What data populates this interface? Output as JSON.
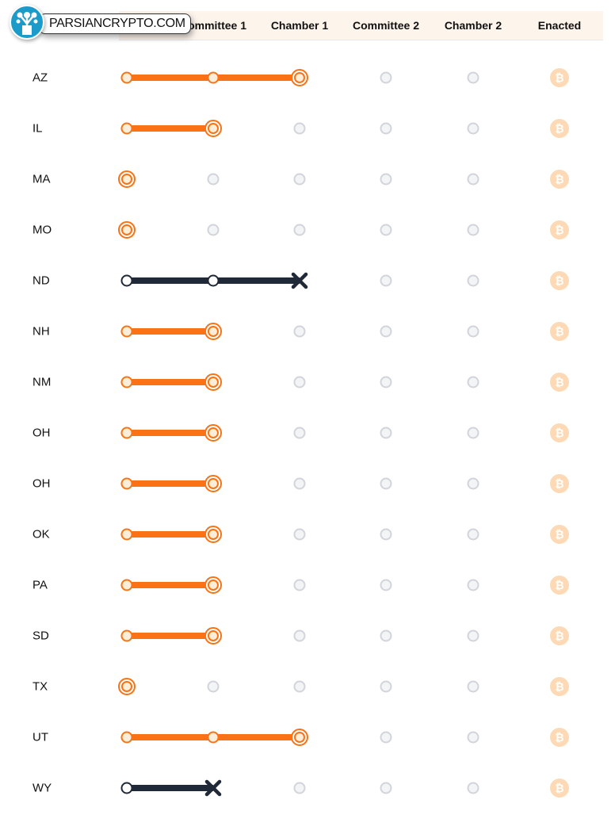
{
  "header": {
    "columns": [
      "Committee 1",
      "Chamber 1",
      "Committee 2",
      "Chamber 2",
      "Enacted"
    ]
  },
  "watermark": {
    "text": "PARSIANCRYPTO.COM"
  },
  "colors": {
    "active": "#f97316",
    "active_fill": "#ffedd5",
    "failed": "#1f2937",
    "pending_fill": "#f3f4f6",
    "pending_stroke": "#d1d5db",
    "enacted": "#fdd9b5"
  },
  "icons": {
    "enacted": "bitcoin-icon",
    "failed": "x-icon"
  },
  "rows": [
    {
      "state": "AZ",
      "stage": 2,
      "status": "active"
    },
    {
      "state": "IL",
      "stage": 1,
      "status": "active"
    },
    {
      "state": "MA",
      "stage": 0,
      "status": "active"
    },
    {
      "state": "MO",
      "stage": 0,
      "status": "active"
    },
    {
      "state": "ND",
      "stage": 2,
      "status": "failed"
    },
    {
      "state": "NH",
      "stage": 1,
      "status": "active"
    },
    {
      "state": "NM",
      "stage": 1,
      "status": "active"
    },
    {
      "state": "OH",
      "stage": 1,
      "status": "active"
    },
    {
      "state": "OH",
      "stage": 1,
      "status": "active"
    },
    {
      "state": "OK",
      "stage": 1,
      "status": "active"
    },
    {
      "state": "PA",
      "stage": 1,
      "status": "active"
    },
    {
      "state": "SD",
      "stage": 1,
      "status": "active"
    },
    {
      "state": "TX",
      "stage": 0,
      "status": "active"
    },
    {
      "state": "UT",
      "stage": 2,
      "status": "active"
    },
    {
      "state": "WY",
      "stage": 1,
      "status": "failed"
    }
  ]
}
